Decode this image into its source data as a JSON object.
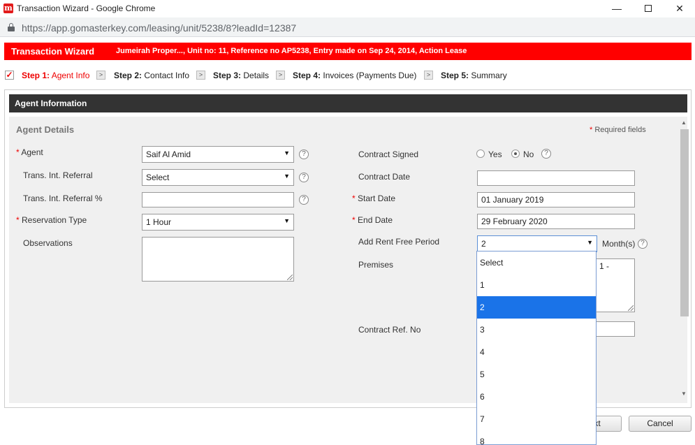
{
  "window": {
    "title": "Transaction Wizard - Google Chrome",
    "logo_letter": "m",
    "minimize": "—",
    "close": "✕",
    "url": "https://app.gomasterkey.com/leasing/unit/5238/8?leadId=12387"
  },
  "header": {
    "title": "Transaction Wizard",
    "info": "Jumeirah Proper..., Unit no: 11, Reference no AP5238, Entry made on Sep 24, 2014, Action Lease"
  },
  "steps": [
    {
      "num": "Step 1:",
      "label": "Agent Info",
      "active": true
    },
    {
      "num": "Step 2:",
      "label": "Contact Info",
      "active": false
    },
    {
      "num": "Step 3:",
      "label": "Details",
      "active": false
    },
    {
      "num": "Step 4:",
      "label": "Invoices (Payments Due)",
      "active": false
    },
    {
      "num": "Step 5:",
      "label": "Summary",
      "active": false
    }
  ],
  "step_check": "✓",
  "step_sep": ">",
  "section": {
    "title": "Agent Information",
    "subtitle": "Agent Details",
    "required_star": "*",
    "required_note": "Required fields"
  },
  "left_form": {
    "agent_label": "Agent",
    "agent_value": "Saif Al Amid",
    "referral_label": "Trans. Int. Referral",
    "referral_value": "Select",
    "referral_pct_label": "Trans. Int. Referral %",
    "referral_pct_value": "",
    "reservation_label": "Reservation Type",
    "reservation_value": "1 Hour",
    "observations_label": "Observations",
    "observations_value": ""
  },
  "right_form": {
    "contract_signed_label": "Contract Signed",
    "yes_label": "Yes",
    "no_label": "No",
    "contract_signed_value": "No",
    "contract_date_label": "Contract Date",
    "contract_date_value": "",
    "start_date_label": "Start Date",
    "start_date_value": "01 January 2019",
    "end_date_label": "End Date",
    "end_date_value": "29 February 2020",
    "rent_free_label": "Add Rent Free Period",
    "rent_free_value": "2",
    "months_label": "Month(s)",
    "premises_label": "Premises",
    "premises_value": "1 -",
    "contract_ref_label": "Contract Ref. No",
    "contract_ref_value": ""
  },
  "dropdown": {
    "options": [
      "Select",
      "1",
      "2",
      "3",
      "4",
      "5",
      "6",
      "7",
      "8"
    ],
    "selected": "2"
  },
  "help_glyph": "?",
  "arrow_glyph": "▼",
  "scroll_up": "▲",
  "scroll_down": "▼",
  "buttons": {
    "next_label": "xt",
    "cancel_label": "Cancel"
  }
}
